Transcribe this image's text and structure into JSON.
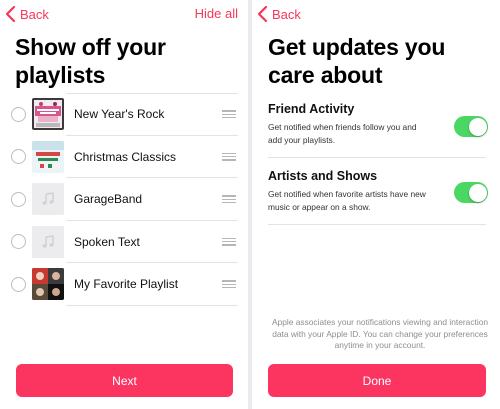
{
  "left_screen": {
    "nav": {
      "back_label": "Back",
      "hide_all_label": "Hide all"
    },
    "title": "Show off your playlists",
    "playlists": [
      {
        "name": "New Year's Rock",
        "artwork": "new-years-rock-artwork"
      },
      {
        "name": "Christmas Classics",
        "artwork": "christmas-classics-artwork"
      },
      {
        "name": "GarageBand",
        "artwork": "music-note-placeholder"
      },
      {
        "name": "Spoken Text",
        "artwork": "music-note-placeholder"
      },
      {
        "name": "My Favorite Playlist",
        "artwork": "favorite-playlist-artwork"
      }
    ],
    "next_label": "Next"
  },
  "right_screen": {
    "nav": {
      "back_label": "Back"
    },
    "title": "Get updates you care about",
    "settings": [
      {
        "title": "Friend Activity",
        "description": "Get notified when friends follow you and add your playlists.",
        "enabled": true
      },
      {
        "title": "Artists and Shows",
        "description": "Get notified when favorite artists have new music or appear on a show.",
        "enabled": true
      }
    ],
    "footer_note": "Apple associates your notifications viewing and interaction data with your Apple ID. You can change your preferences anytime in your account.",
    "done_label": "Done"
  },
  "colors": {
    "accent": "#f7365a",
    "button": "#fb3560",
    "toggle_on": "#4bd763",
    "separator": "#e3e3e6"
  }
}
